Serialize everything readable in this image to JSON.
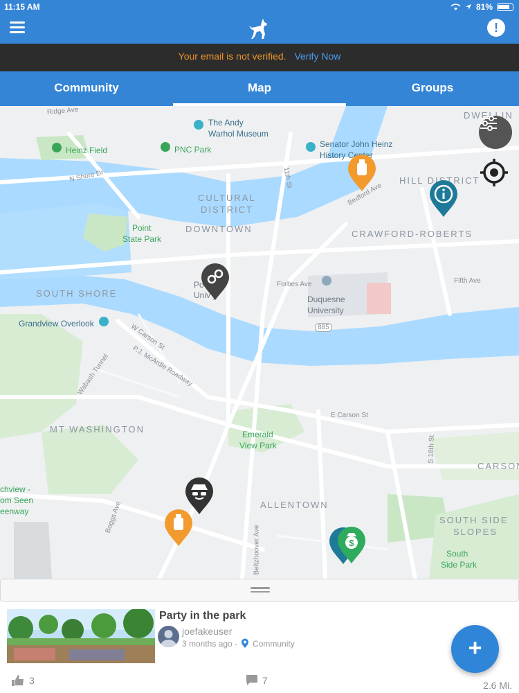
{
  "status_bar": {
    "time": "11:15 AM",
    "battery": "81%"
  },
  "header": {
    "menu_icon": "hamburger-icon",
    "logo_icon": "wolf-icon",
    "alert_icon": "alert-icon",
    "alert_symbol": "!"
  },
  "verify_banner": {
    "message": "Your email is not verified.",
    "link": "Verify Now",
    "message_color": "#e8922b",
    "link_color": "#4b9cf0"
  },
  "tabs": [
    {
      "label": "Community",
      "active": false
    },
    {
      "label": "Map",
      "active": true
    },
    {
      "label": "Groups",
      "active": false
    }
  ],
  "map": {
    "districts": [
      "CULTURAL DISTRICT",
      "DOWNTOWN",
      "HILL DISTRICT",
      "CRAWFORD-ROBERTS",
      "SOUTH SHORE",
      "MT WASHINGTON",
      "ALLENTOWN",
      "SOUTH SIDE SLOPES",
      "CARSON",
      "BEDFORD DWELLING"
    ],
    "parks": [
      "Heinz Field",
      "PNC Park",
      "Point State Park",
      "Emerald View Park",
      "South Side Park",
      "Grandview Overlook"
    ],
    "pois": [
      "The Andy Warhol Museum",
      "Senator John Heinz History Center",
      "Duquesne University",
      "Point Park University"
    ],
    "roads": [
      "Ridge Ave",
      "N Shore Dr",
      "11th St",
      "Bedford Ave",
      "Forbes Ave",
      "Fifth Ave",
      "W Carson St",
      "P.J. McArdle Roadway",
      "Wabash Tunnel",
      "E Carson St",
      "S 18th St",
      "Boggs Ave",
      "Beltzhoover Ave",
      "885"
    ],
    "partial_labels": [
      "chview -",
      "om Seen",
      "eenway"
    ],
    "pins": [
      {
        "type": "bottle",
        "color": "#f29a2e"
      },
      {
        "type": "info",
        "color": "#1f7a99"
      },
      {
        "type": "handcuffs",
        "color": "#444444"
      },
      {
        "type": "spy",
        "color": "#333333"
      },
      {
        "type": "bottle",
        "color": "#f29a2e"
      },
      {
        "type": "money",
        "color": "#2eab5c"
      }
    ],
    "controls": [
      "filter-icon",
      "locate-icon"
    ]
  },
  "feed_item": {
    "title": "Party in the park",
    "username": "joefakeuser",
    "time_ago": "3 months ago -",
    "group": "Community",
    "likes": "3",
    "comments": "7",
    "distance": "2.6 Mi."
  },
  "fab_label": "+"
}
